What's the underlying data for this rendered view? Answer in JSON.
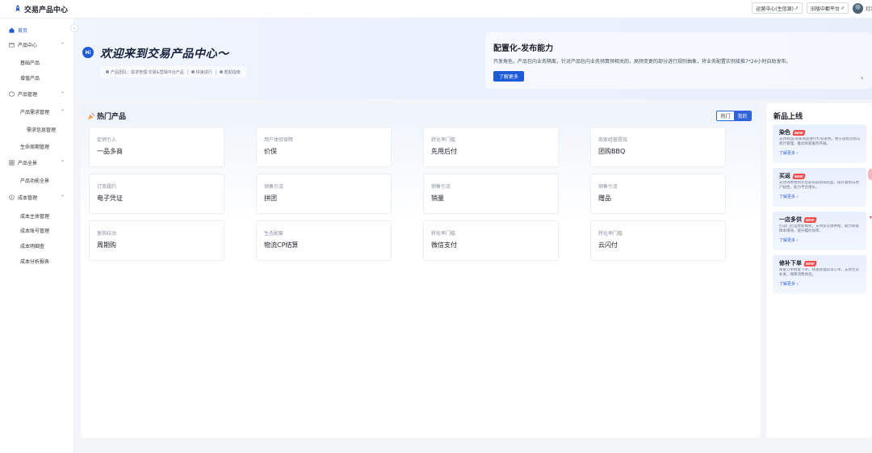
{
  "app": {
    "title": "交易产品中心"
  },
  "topbar": {
    "buttons": [
      "运营中心(生信源)",
      "旧版中都平台"
    ],
    "username": "灯泡"
  },
  "sidebar": {
    "items": [
      {
        "label": "首页",
        "level": 0,
        "active": true
      },
      {
        "label": "产品中心",
        "level": 0,
        "expand": true
      },
      {
        "label": "基础产品",
        "level": 1
      },
      {
        "label": "增值产品",
        "level": 1
      },
      {
        "label": "产品管理",
        "level": 0,
        "expand": true
      },
      {
        "label": "产品需求管理",
        "level": 1,
        "expand": true
      },
      {
        "label": "需求信息管理",
        "level": 2
      },
      {
        "label": "生命周期管理",
        "level": 1
      },
      {
        "label": "产品全景",
        "level": 0,
        "expand": true
      },
      {
        "label": "产品功能全景",
        "level": 1
      },
      {
        "label": "成本管理",
        "level": 0,
        "expand": true
      },
      {
        "label": "成本主体管理",
        "level": 1
      },
      {
        "label": "成本账号管理",
        "level": 1
      },
      {
        "label": "成本明细查",
        "level": 1
      },
      {
        "label": "成本分析报表",
        "level": 1
      }
    ]
  },
  "banner": {
    "hi": "Hi",
    "welcome": "欢迎来到交易产品中心～",
    "chips": [
      "产品团队：需求管理-交易&营销平台产品",
      "快速进行",
      "帮助指南"
    ],
    "config_title": "配置化-发布能力",
    "config_desc": "开发角色，产品包内业务隔离，针对产品包内业务预算预相关的，高频变更的部分进行规则抽象，将业务配置实例接推7*24小时自助发布。",
    "learn_more": "了解更多",
    "arrow": "›"
  },
  "hot": {
    "title": "热门产品",
    "toggle": [
      "热门",
      "我的"
    ],
    "cards": [
      {
        "category": "促销引入",
        "name": "一品多商"
      },
      {
        "category": "用户体验保障",
        "name": "价保"
      },
      {
        "category": "转化率门槛",
        "name": "先用后付"
      },
      {
        "category": "商家经营提效",
        "name": "团购BBQ"
      },
      {
        "category": "订单履约",
        "name": "电子凭证"
      },
      {
        "category": "销售引流",
        "name": "拼团"
      },
      {
        "category": "销售引流",
        "name": "销量"
      },
      {
        "category": "销售引流",
        "name": "赠品"
      },
      {
        "category": "复购拉动",
        "name": "周期购"
      },
      {
        "category": "生态配套",
        "name": "物流CP结算"
      },
      {
        "category": "转化率门槛",
        "name": "微信支付"
      },
      {
        "category": "转化率门槛",
        "name": "云闪付"
      }
    ]
  },
  "new_products": {
    "title": "新品上线",
    "tag": "NEW",
    "more_label": "了解更多 ›",
    "cards": [
      {
        "name": "染色",
        "desc": "支持商品/商家商品进行打标染色，便于后续识别与统计管理，推动商家服务开展。"
      },
      {
        "name": "买返",
        "desc": "支持消费者购买后获得返现或权益，提升复购与用户粘性，助力平台增长。"
      },
      {
        "name": "一店多供",
        "desc": "打造门店运营新模式，支持多货源供给，助力商家降本增效，提升履约效率。"
      },
      {
        "name": "修补下单",
        "desc": "商家订单修复下单，快速处理异常订单，支持无货补发，保障消费体验。"
      }
    ]
  },
  "colors": {
    "accent": "#1f5bd8",
    "new_tag": "#f04d4d"
  }
}
